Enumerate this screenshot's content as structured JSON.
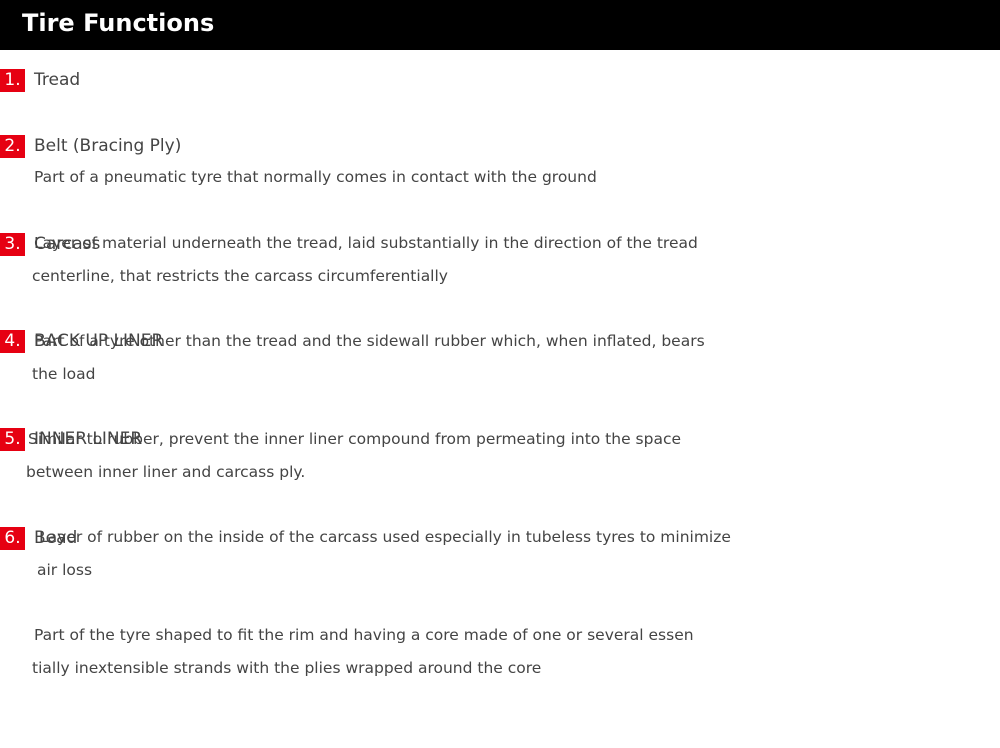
{
  "header": {
    "title": "Tire Functions",
    "background_color": "#000000",
    "text_color": "#ffffff"
  },
  "accent_color": "#e60012",
  "items": [
    {
      "number": "1.",
      "title": "Tread",
      "lines": [
        "Part of a pneumatic tyre that normally comes in contact with the ground"
      ]
    },
    {
      "number": "2.",
      "title": "Belt (Bracing Ply)",
      "lines": [
        "Layer of material underneath the tread, laid substantially in the direction of the tread",
        "centerline, that restricts the carcass circumferentially"
      ]
    },
    {
      "number": "3.",
      "title": "Carcass",
      "lines": [
        "Part of a tyre other than the tread and the sidewall rubber which, when inflated, bears",
        "the load"
      ]
    },
    {
      "number": "4.",
      "title": "BACK UP LINER",
      "lines": [
        "Similar to rubber, prevent the inner liner compound from permeating into the space",
        "between inner liner and carcass ply."
      ]
    },
    {
      "number": "5.",
      "title": "INNER LINER",
      "lines": [
        "Layer of rubber on the inside of the carcass used especially in tubeless tyres to minimize",
        "air loss"
      ]
    },
    {
      "number": "6.",
      "title": "Bead",
      "lines": [
        "Part of the tyre shaped to fit the rim and having a core made of one or several essen",
        "tially inextensible strands with the plies wrapped around the core"
      ]
    }
  ]
}
